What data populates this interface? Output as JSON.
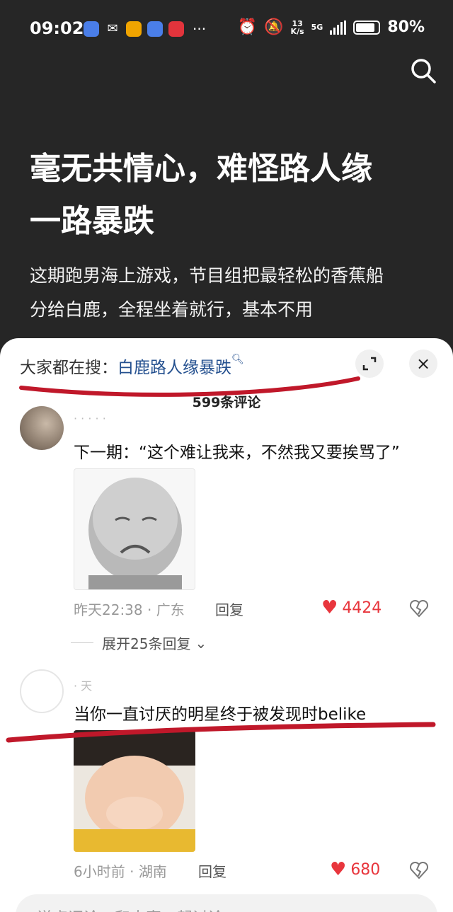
{
  "status_bar": {
    "time": "09:02",
    "more": "···",
    "net_speed_value": "13",
    "net_speed_unit": "K/s",
    "network": "5G",
    "battery": "80%"
  },
  "article": {
    "title": "毫无共情心，难怪路人缘一路暴跌",
    "body": "这期跑男海上游戏，节目组把最轻松的香蕉船分给白鹿，全程坐着就行，基本不用"
  },
  "sheet": {
    "hot_search_prefix": "大家都在搜：",
    "hot_search_term": "白鹿路人缘暴跌",
    "close": "×",
    "comment_count": "599条评论",
    "bottom_placeholder": "说点评论，和大家一起讨论"
  },
  "comments": [
    {
      "username": "· · · · ·",
      "text": "下一期：“这个难让我来，不然我又要挨骂了”",
      "time": "昨天22:38",
      "location": "广东",
      "reply": "回复",
      "likes": "4424",
      "expand_replies": "展开25条回复"
    },
    {
      "username": "· 天",
      "text": "当你一直讨厌的明星终于被发现时belike",
      "time": "6小时前",
      "location": "湖南",
      "reply": "回复",
      "likes": "680"
    }
  ],
  "colors": {
    "background": "#262626",
    "hot_term": "#24508f",
    "like": "#e8363d",
    "annotation": "#c0182a"
  }
}
